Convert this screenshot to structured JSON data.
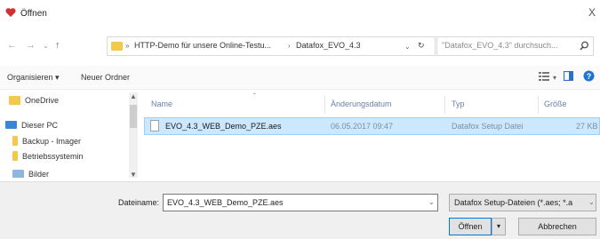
{
  "window": {
    "title": "Öffnen",
    "close_glyph": "X"
  },
  "nav": {
    "back": "←",
    "forward": "→",
    "recent": "⌄",
    "up": "↑"
  },
  "address": {
    "sep1": "»",
    "crumb1": "HTTP-Demo für unsere Online-Testu...",
    "sep2": "›",
    "crumb2": "Datafox_EVO_4.3",
    "refresh": "↻"
  },
  "search": {
    "placeholder": "\"Datafox_EVO_4.3\" durchsuch...",
    "icon": "search-icon"
  },
  "toolbar": {
    "organize": "Organisieren ▾",
    "new_folder": "Neuer Ordner"
  },
  "sidebar": {
    "items": [
      {
        "label": "OneDrive",
        "icon": "folder-icon"
      },
      {
        "label": "Dieser PC",
        "icon": "computer-icon"
      },
      {
        "label": "Backup - Imager",
        "icon": "folder-icon"
      },
      {
        "label": "Betriebssystemin",
        "icon": "folder-icon"
      },
      {
        "label": "Bilder",
        "icon": "pictures-icon"
      }
    ]
  },
  "columns": {
    "name": "Name",
    "date": "Änderungsdatum",
    "type": "Typ",
    "size": "Größe"
  },
  "files": [
    {
      "name": "EVO_4.3_WEB_Demo_PZE.aes",
      "date": "06.05.2017 09:47",
      "type": "Datafox Setup Datei",
      "size": "27 KB",
      "selected": true
    }
  ],
  "footer": {
    "filename_label": "Dateiname:",
    "filename_value": "EVO_4.3_WEB_Demo_PZE.aes",
    "filter_value": "Datafox Setup-Dateien (*.aes; *.a",
    "open_label": "Öffnen",
    "cancel_label": "Abbrechen"
  },
  "colors": {
    "selection": "#cce8ff",
    "selection_border": "#99d1ff",
    "accent": "#0078d7"
  }
}
